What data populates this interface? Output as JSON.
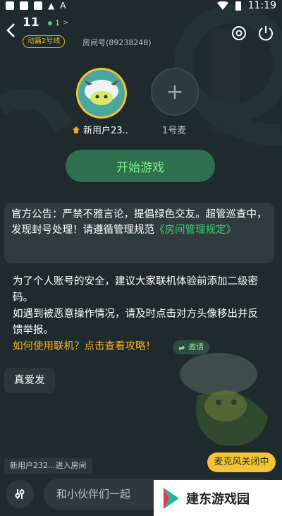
{
  "status_bar": {
    "time": "11:19",
    "warn_glyph": "▲",
    "app_glyph": "A"
  },
  "header": {
    "back_icon": "chevron-left-icon",
    "room_number": "11",
    "online_count": "1",
    "online_chevron": ">",
    "line_tag": "动篇2号线",
    "room_id": "房间号(89238248)",
    "settings_icon": "target-settings-icon",
    "power_icon": "power-icon"
  },
  "seats": [
    {
      "name": "新用户23..",
      "is_host": true
    },
    {
      "name": "1号麦",
      "plus": "+"
    }
  ],
  "start_button": "开始游戏",
  "notice": {
    "text": "官方公告：严禁不雅言论，提倡绿色交友。超管巡查中，发现封号处理！请遵循管理规范",
    "link": "《房间管理规定》"
  },
  "tip": {
    "line1": "为了个人账号的安全，建议大家联机体验前添加二级密码。",
    "line2": "如遇到被恶意操作情况，请及时点击对方头像移出并反馈举报。",
    "guide": "如何使用联机？点击查看攻略！",
    "invite_label": "邀请"
  },
  "chat_message": "真爱发",
  "entry_message": "新用户232...进入房间",
  "mic_status": "麦克风关闭中",
  "chat_input": {
    "placeholder": "和小伙伴们一起"
  },
  "watermark": {
    "text": "建东游戏园"
  },
  "colors": {
    "background": "#1e2a2c",
    "accent_green": "#39d07c",
    "accent_yellow": "#f4c531",
    "guide_orange": "#f5b324"
  }
}
